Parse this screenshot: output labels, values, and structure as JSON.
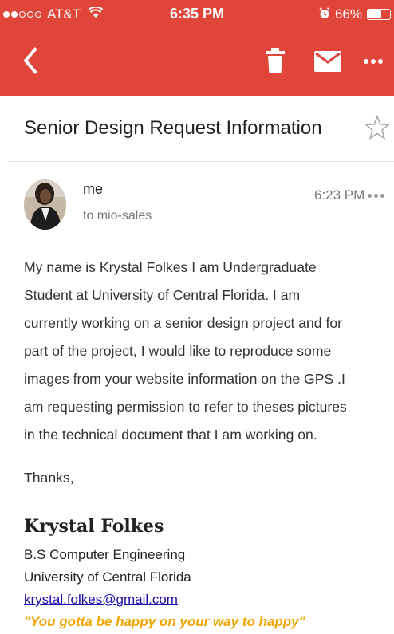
{
  "status_bar": {
    "carrier": "AT&T",
    "time": "6:35 PM",
    "battery_percent": "66%",
    "battery_level": 0.66,
    "signal_bars_filled": 2,
    "signal_bars_total": 5
  },
  "toolbar": {
    "back_icon": "chevron-left-icon",
    "delete_icon": "trash-icon",
    "mail_icon": "envelope-icon",
    "more_icon": "more-horizontal-icon",
    "accent_color": "#e0453a"
  },
  "email": {
    "subject": "Senior Design Request Information",
    "sender": "me",
    "recipient": "to mio-sales",
    "time": "6:23 PM",
    "body_lines": [
      "My name is Krystal Folkes I am Undergraduate",
      "Student at University of Central Florida. I am",
      "currently working on a senior design project and for",
      "part of the project, I would like to reproduce some",
      "images from your website information on the GPS .I",
      "am requesting permission to refer to theses pictures",
      "in the technical document that I am working on."
    ],
    "closing": "Thanks,"
  },
  "signature": {
    "name": "Krystal Folkes",
    "degree": "B.S Computer Engineering",
    "university": "University of Central Florida",
    "email": "krystal.folkes@gmail.com",
    "quote": "\"You gotta be happy on your way to happy\""
  }
}
